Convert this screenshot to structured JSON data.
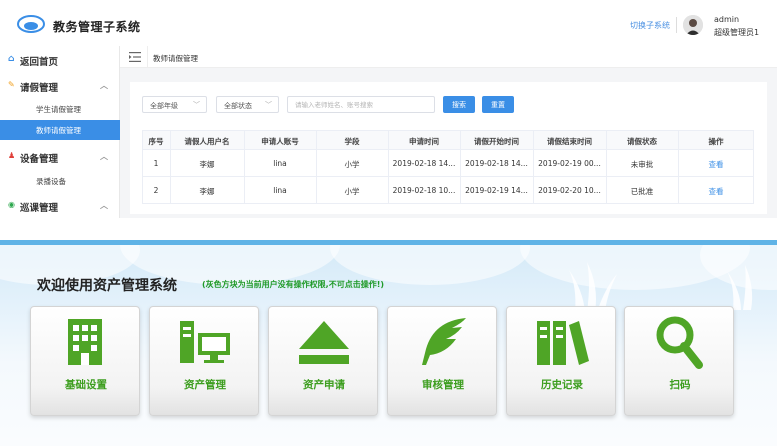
{
  "app": {
    "title": "教务管理子系统",
    "switch_label": "切换子系统",
    "user": {
      "name": "admin",
      "role": "超级管理员1"
    }
  },
  "sidebar": {
    "home": "返回首页",
    "groups": [
      {
        "label": "请假管理",
        "items": [
          "学生请假管理",
          "教师请假管理"
        ]
      },
      {
        "label": "设备管理",
        "items": [
          "录播设备"
        ]
      },
      {
        "label": "巡课管理",
        "items": []
      }
    ]
  },
  "breadcrumb": "教师请假管理",
  "filters": {
    "grade": "全部年级",
    "status": "全部状态",
    "search_placeholder": "请输入老师姓名、账号搜索",
    "search_button": "搜索",
    "reset_button": "重置"
  },
  "table": {
    "headers": [
      "序号",
      "请假人用户名",
      "申请人账号",
      "学段",
      "申请时间",
      "请假开始时间",
      "请假结束时间",
      "请假状态",
      "操作"
    ],
    "rows": [
      [
        "1",
        "李娜",
        "lina",
        "小学",
        "2019-02-18 14...",
        "2019-02-18 14...",
        "2019-02-19 00...",
        "未审批",
        "查看"
      ],
      [
        "2",
        "李娜",
        "lina",
        "小学",
        "2019-02-18 10...",
        "2019-02-19 14...",
        "2019-02-20 10...",
        "已批准",
        "查看"
      ]
    ]
  },
  "asset": {
    "welcome": "欢迎使用资产管理系统",
    "notice": "(灰色方块为当前用户没有操作权限,不可点击操作!)",
    "tiles": [
      {
        "label": "基础设置",
        "icon": "building-icon"
      },
      {
        "label": "资产管理",
        "icon": "computer-icon"
      },
      {
        "label": "资产申请",
        "icon": "eject-icon"
      },
      {
        "label": "审核管理",
        "icon": "feather-icon"
      },
      {
        "label": "历史记录",
        "icon": "books-icon"
      },
      {
        "label": "扫码",
        "icon": "magnifier-icon"
      }
    ]
  },
  "colors": {
    "accent": "#3a8ee6",
    "tile_icon": "#4fa526",
    "tile_label": "#3d9e1f",
    "notice": "#1f9a28"
  }
}
